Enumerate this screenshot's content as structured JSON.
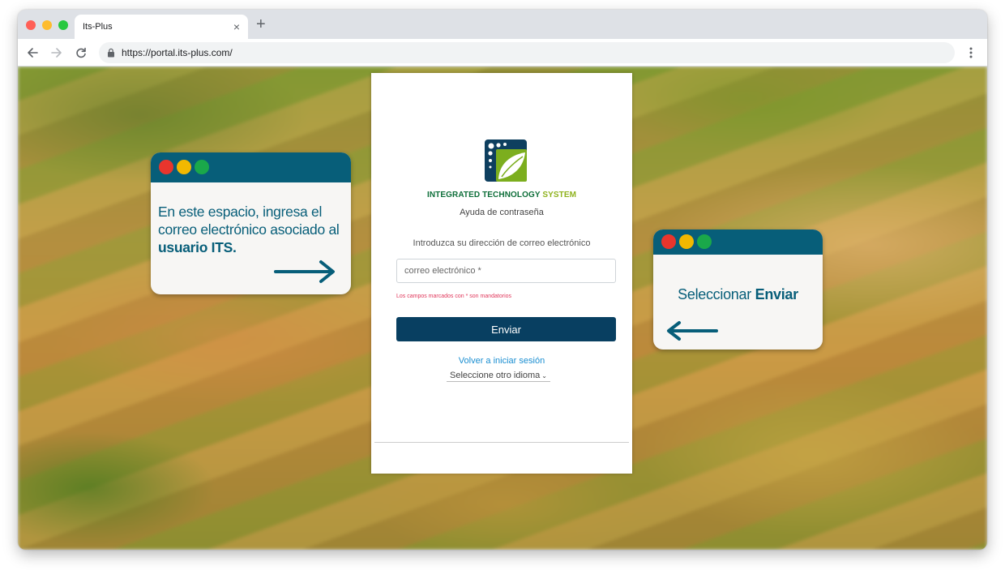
{
  "browser": {
    "tab_title": "Its-Plus",
    "tab_close": "×",
    "new_tab": "+",
    "url": "https://portal.its-plus.com/",
    "traffic_colors": [
      "#ff5f57",
      "#febc2e",
      "#28c840"
    ]
  },
  "login_card": {
    "brand_part1": "INTEGRATED TECHNOLOGY",
    "brand_part2": "SYSTEM",
    "subtitle": "Ayuda de contraseña",
    "instruction": "Introduzca su dirección de correo electrónico",
    "email_placeholder": "correo electrónico *",
    "email_value": "",
    "mandatory_note": "Los campos marcados con * son mandatorios",
    "submit_label": "Enviar",
    "back_link": "Volver a iniciar sesión",
    "language_label": "Seleccione otro idioma",
    "language_chevron": "⌄"
  },
  "callout_left": {
    "text_before": "En este espacio, ingresa el correo electrónico asociado al ",
    "text_bold": "usuario ITS."
  },
  "callout_right": {
    "text_before": "Seleccionar ",
    "text_bold": "Enviar"
  },
  "colors": {
    "primary": "#083f61",
    "callout_header": "#075e79",
    "link": "#1a8ed1",
    "error": "#e0365a",
    "brand_green": "#0e6f3a",
    "brand_lime": "#8fb21e",
    "callout_dots": [
      "#e8352d",
      "#f2b800",
      "#1aa84a"
    ]
  }
}
